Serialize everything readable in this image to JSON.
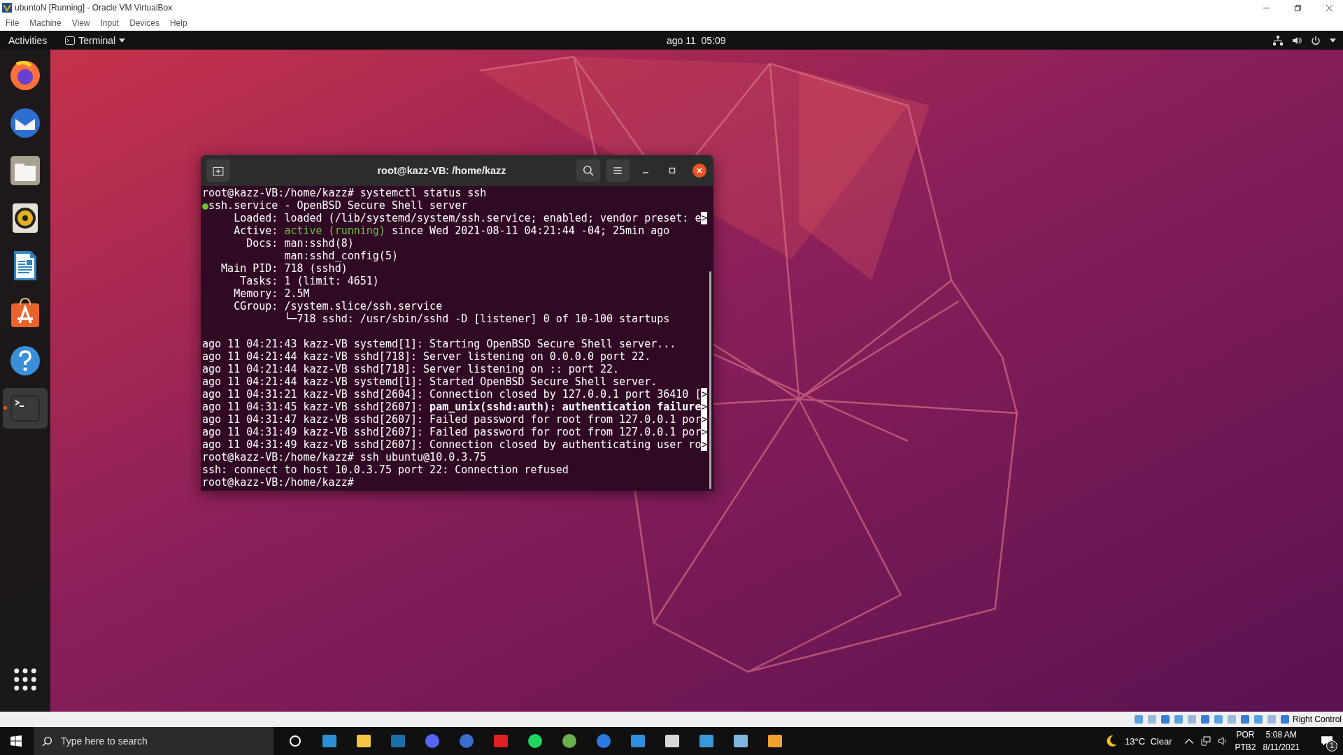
{
  "vm_window": {
    "title": "ubuntoN [Running] - Oracle VM VirtualBox",
    "menu": [
      "File",
      "Machine",
      "View",
      "Input",
      "Devices",
      "Help"
    ]
  },
  "top_bar": {
    "activities": "Activities",
    "app_menu": "Terminal",
    "clock": "ago 11  05:09"
  },
  "dock": {
    "items": [
      {
        "kind": "browser",
        "selected": false
      },
      {
        "kind": "mail",
        "selected": false
      },
      {
        "kind": "files",
        "selected": false
      },
      {
        "kind": "music",
        "selected": false
      },
      {
        "kind": "document",
        "selected": false
      },
      {
        "kind": "store",
        "selected": false
      },
      {
        "kind": "help",
        "selected": false
      },
      {
        "kind": "terminal",
        "selected": true
      }
    ]
  },
  "terminal": {
    "title": "root@kazz-VB: /home/kazz",
    "lines": [
      {
        "segments": [
          {
            "text": "root@kazz-VB:/home/kazz# systemctl status ssh",
            "kind": "plain"
          }
        ]
      },
      {
        "segments": [
          {
            "text": "●",
            "kind": "green"
          },
          {
            "text": "ssh.service - OpenBSD Secure Shell server",
            "kind": "plain"
          }
        ]
      },
      {
        "segments": [
          {
            "text": "     Loaded: loaded (/lib/systemd/system/ssh.service; enabled; vendor preset: e",
            "kind": "plain"
          },
          {
            "text": ">",
            "kind": "overflow"
          }
        ]
      },
      {
        "segments": [
          {
            "text": "     Active: ",
            "kind": "plain"
          },
          {
            "text": "active (running)",
            "kind": "green"
          },
          {
            "text": " since Wed 2021-08-11 04:21:44 -04; 25min ago",
            "kind": "plain"
          }
        ]
      },
      {
        "segments": [
          {
            "text": "       Docs: man:sshd(8)",
            "kind": "plain"
          }
        ]
      },
      {
        "segments": [
          {
            "text": "             man:sshd_config(5)",
            "kind": "plain"
          }
        ]
      },
      {
        "segments": [
          {
            "text": "   Main PID: 718 (sshd)",
            "kind": "plain"
          }
        ]
      },
      {
        "segments": [
          {
            "text": "      Tasks: 1 (limit: 4651)",
            "kind": "plain"
          }
        ]
      },
      {
        "segments": [
          {
            "text": "     Memory: 2.5M",
            "kind": "plain"
          }
        ]
      },
      {
        "segments": [
          {
            "text": "     CGroup: /system.slice/ssh.service",
            "kind": "plain"
          }
        ]
      },
      {
        "segments": [
          {
            "text": "             └─718 sshd: /usr/sbin/sshd -D [listener] 0 of 10-100 startups",
            "kind": "plain"
          }
        ]
      },
      {
        "gap_before": true,
        "segments": [
          {
            "text": "ago 11 04:21:43 kazz-VB systemd[1]: Starting OpenBSD Secure Shell server...",
            "kind": "plain"
          }
        ]
      },
      {
        "segments": [
          {
            "text": "ago 11 04:21:44 kazz-VB sshd[718]: Server listening on 0.0.0.0 port 22.",
            "kind": "plain"
          }
        ]
      },
      {
        "segments": [
          {
            "text": "ago 11 04:21:44 kazz-VB sshd[718]: Server listening on :: port 22.",
            "kind": "plain"
          }
        ]
      },
      {
        "segments": [
          {
            "text": "ago 11 04:21:44 kazz-VB systemd[1]: Started OpenBSD Secure Shell server.",
            "kind": "plain"
          }
        ]
      },
      {
        "segments": [
          {
            "text": "ago 11 04:31:21 kazz-VB sshd[2604]: Connection closed by 127.0.0.1 port 36410 [",
            "kind": "plain"
          },
          {
            "text": ">",
            "kind": "overflow"
          }
        ]
      },
      {
        "segments": [
          {
            "text": "ago 11 04:31:45 kazz-VB sshd[2607]: ",
            "kind": "plain"
          },
          {
            "text": "pam_unix(sshd:auth): authentication failure",
            "kind": "bold"
          },
          {
            "text": ">",
            "kind": "overflow"
          }
        ]
      },
      {
        "segments": [
          {
            "text": "ago 11 04:31:47 kazz-VB sshd[2607]: Failed password for root from 127.0.0.1 por",
            "kind": "plain"
          },
          {
            "text": ">",
            "kind": "overflow"
          }
        ]
      },
      {
        "segments": [
          {
            "text": "ago 11 04:31:49 kazz-VB sshd[2607]: Failed password for root from 127.0.0.1 por",
            "kind": "plain"
          },
          {
            "text": ">",
            "kind": "overflow"
          }
        ]
      },
      {
        "segments": [
          {
            "text": "ago 11 04:31:49 kazz-VB sshd[2607]: Connection closed by authenticating user ro",
            "kind": "plain"
          },
          {
            "text": ">",
            "kind": "overflow"
          }
        ]
      },
      {
        "segments": [
          {
            "text": "root@kazz-VB:/home/kazz# ssh ubuntu@10.0.3.75",
            "kind": "plain"
          }
        ]
      },
      {
        "segments": [
          {
            "text": "ssh: connect to host 10.0.3.75 port 22: Connection refused",
            "kind": "plain"
          }
        ]
      },
      {
        "segments": [
          {
            "text": "root@kazz-VB:/home/kazz#",
            "kind": "plain"
          }
        ]
      }
    ]
  },
  "vm_status_bar": {
    "host_key": "Right Control"
  },
  "taskbar": {
    "search": {
      "placeholder": "Type here to search"
    },
    "apps": [
      {
        "kind": "cortana"
      },
      {
        "kind": "w"
      },
      {
        "kind": "folder"
      },
      {
        "kind": "steam"
      },
      {
        "kind": "chat"
      },
      {
        "kind": "orb"
      },
      {
        "kind": "red"
      },
      {
        "kind": "spotify"
      },
      {
        "kind": "xbox"
      },
      {
        "kind": "s"
      },
      {
        "kind": "code"
      },
      {
        "kind": "cube"
      },
      {
        "kind": "window"
      },
      {
        "kind": "pen"
      },
      {
        "kind": "paint"
      }
    ],
    "weather": "13°C  Clear",
    "language": "POR",
    "layout": "PTB2",
    "time": "5:08 AM",
    "date": "8/11/2021",
    "notifications": "1"
  }
}
